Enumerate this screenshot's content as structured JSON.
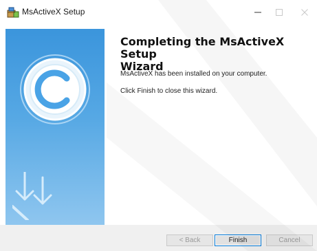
{
  "window": {
    "title": "MsActiveX Setup"
  },
  "content": {
    "heading_line1": "Completing the MsActiveX Setup",
    "heading_line2": "Wizard",
    "message_installed": "MsActiveX has been installed on your computer.",
    "message_finish": "Click Finish to close this wizard."
  },
  "buttons": {
    "back_label": "< Back",
    "finish_label": "Finish",
    "cancel_label": "Cancel"
  },
  "icons": {
    "app": "installer-box-icon",
    "minimize": "minimize-icon",
    "maximize": "maximize-icon",
    "close": "close-icon",
    "logo": "circular-c-logo-icon",
    "arrows": "down-arrows-icon"
  },
  "colors": {
    "side_panel_top": "#3b95dc",
    "side_panel_bottom": "#8fc6ef",
    "default_button_border": "#0078d7",
    "footer_bg": "#f0f0f0"
  }
}
